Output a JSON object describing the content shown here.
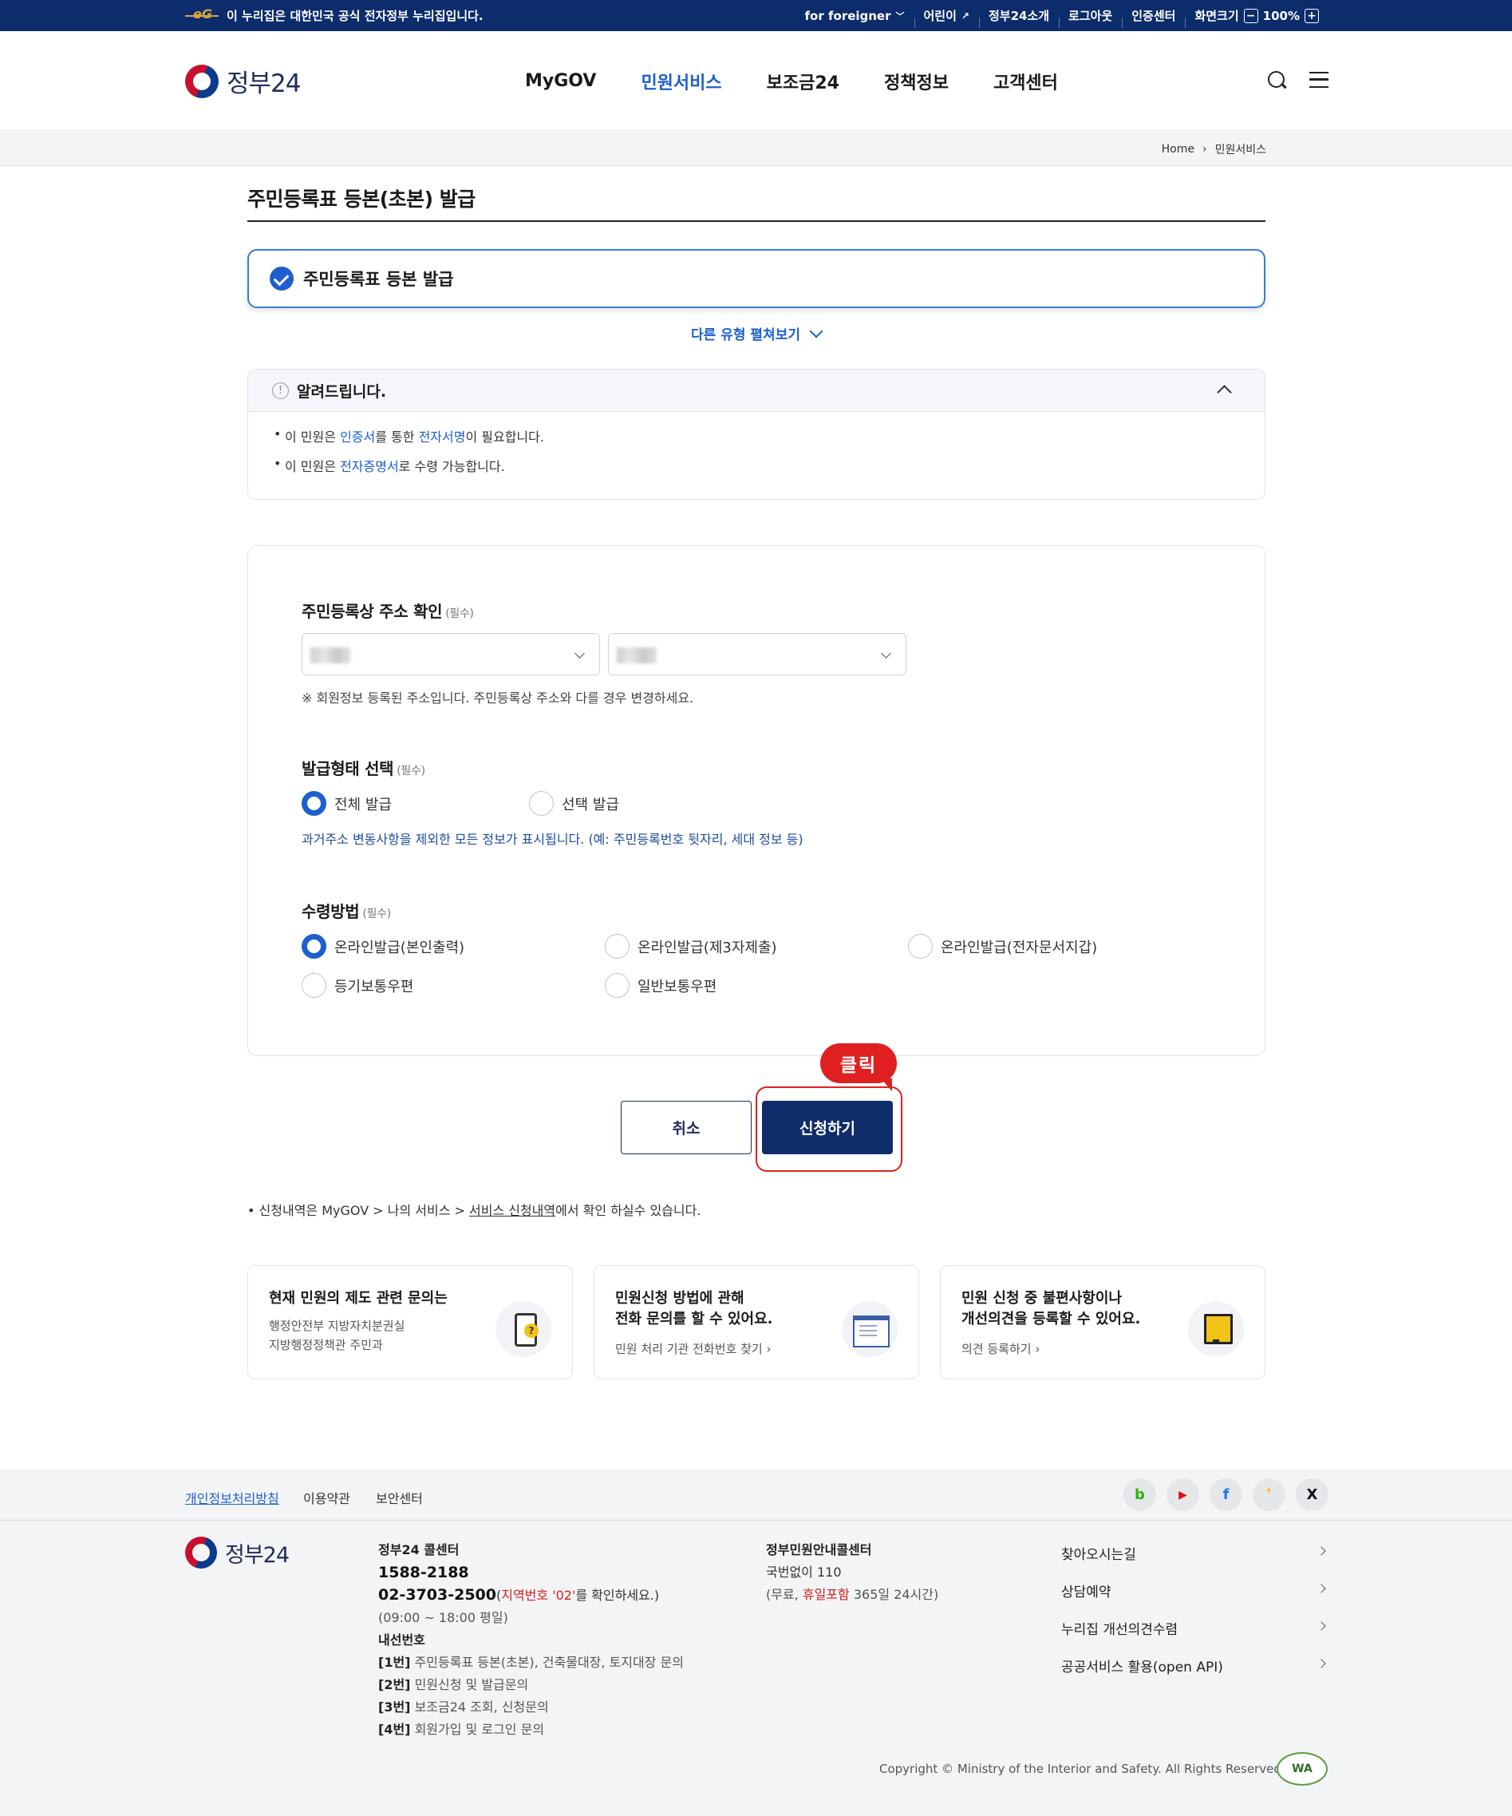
{
  "topbar": {
    "notice": "이 누리집은 대한민국 공식 전자정부 누리집입니다.",
    "util": [
      "for foreigner",
      "어린이",
      "정부24소개",
      "로그아웃",
      "인증센터",
      "화면크기"
    ],
    "zoom_minus": "−",
    "zoom_value": "100%",
    "zoom_plus": "+"
  },
  "header": {
    "logo_text": "정부24",
    "nav": [
      "MyGOV",
      "민원서비스",
      "보조금24",
      "정책정보",
      "고객센터"
    ],
    "active_nav": "민원서비스"
  },
  "breadcrumb": {
    "home": "Home",
    "sep": "›",
    "current": "민원서비스"
  },
  "page": {
    "title": "주민등록표 등본(초본) 발급",
    "selected_type": "주민등록표 등본 발급",
    "more_types": "다른 유형 펼쳐보기"
  },
  "notice": {
    "title": "알려드립니다.",
    "item1": {
      "a": "이 민원은 ",
      "link1": "인증서",
      "b": "를 통한 ",
      "link2": "전자서명",
      "c": "이 필요합니다."
    },
    "item2": {
      "a": "이 민원은 ",
      "link1": "전자증명서",
      "b": "로 수령 가능합니다."
    }
  },
  "form": {
    "address_label": "주민등록상 주소 확인",
    "required": "(필수)",
    "address_hint": "※ 회원정보 등록된 주소입니다. 주민등록상 주소와 다를 경우 변경하세요.",
    "issue_label": "발급형태 선택",
    "issue_options": [
      "전체 발급",
      "선택 발급"
    ],
    "issue_hint": "과거주소 변동사항을 제외한 모든 정보가 표시됩니다. (예: 주민등록번호 뒷자리, 세대 정보 등)",
    "receive_label": "수령방법",
    "receive_options": [
      "온라인발급(본인출력)",
      "온라인발급(제3자제출)",
      "온라인발급(전자문서지갑)",
      "등기보통우편",
      "일반보통우편"
    ]
  },
  "buttons": {
    "cancel": "취소",
    "apply": "신청하기",
    "callout": "클릭"
  },
  "apply_note": {
    "a": "신청내역은 MyGOV > 나의 서비스 > ",
    "link": "서비스 신청내역",
    "b": "에서 확인 하실수 있습니다."
  },
  "cards": [
    {
      "title": "현재 민원의 제도 관련 문의는",
      "desc1": "행정안전부 지방자치분권실",
      "desc2": "지방행정정책관 주민과"
    },
    {
      "title1": "민원신청 방법에 관해",
      "title2": "전화 문의를 할 수 있어요.",
      "link": "민원 처리 기관 전화번호 찾기 ›"
    },
    {
      "title1": "민원 신청 중 불편사항이나",
      "title2": "개선의견을 등록할 수 있어요.",
      "link": "의견 등록하기 ›"
    }
  ],
  "footer": {
    "links": [
      "개인정보처리방침",
      "이용약관",
      "보안센터"
    ],
    "social": [
      "b",
      "▶",
      "f",
      "❜",
      "X"
    ],
    "logo_text": "정부24",
    "call_center": {
      "title": "정부24 콜센터",
      "phone1": "1588-2188",
      "phone2": "02-3703-2500",
      "phone2_note_a": "(",
      "phone2_note_red": "지역번호 '02'",
      "phone2_note_b": "를 확인하세요.)",
      "hours": "(09:00 ~ 18:00 평일)",
      "ext_title": "내선번호",
      "ext": [
        {
          "k": "[1번]",
          "v": "주민등록표 등본(초본), 건축물대장, 토지대장 문의"
        },
        {
          "k": "[2번]",
          "v": "민원신청 및 발급문의"
        },
        {
          "k": "[3번]",
          "v": "보조금24 조회, 신청문의"
        },
        {
          "k": "[4번]",
          "v": "회원가입 및 로그인 문의"
        }
      ]
    },
    "gov_center": {
      "title": "정부민원안내콜센터",
      "phone": "국번없이 110",
      "note_a": "(무료, ",
      "note_red": "휴일포함",
      "note_b": " 365일 24시간)"
    },
    "right_links": [
      "찾아오시는길",
      "상담예약",
      "누리집 개선의견수렴",
      "공공서비스 활용(open API)"
    ],
    "copyright": "Copyright © Ministry of the Interior and Safety. All Rights Reserved.",
    "wa_mark": "WA"
  }
}
